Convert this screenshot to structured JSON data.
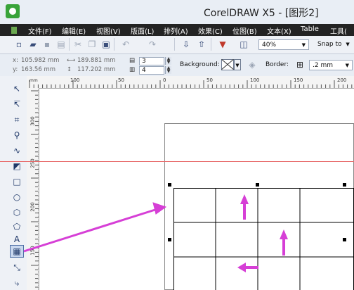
{
  "window": {
    "title": "CorelDRAW X5 - [图形2]"
  },
  "menu": {
    "items": [
      "文件(F)",
      "编辑(E)",
      "视图(V)",
      "版面(L)",
      "排列(A)",
      "效果(C)",
      "位图(B)",
      "文本(X)",
      "Table",
      "工具("
    ]
  },
  "toolbar": {
    "zoom_value": "40%",
    "snap_label": "Snap to"
  },
  "property_bar": {
    "x_label": "x:",
    "x_value": "105.982 mm",
    "y_label": "y:",
    "y_value": "163.56 mm",
    "width_value": "189.881 mm",
    "height_value": "117.202 mm",
    "rows_value": "3",
    "cols_value": "4",
    "background_label": "Background:",
    "border_label": "Border:",
    "border_width": ".2 mm"
  },
  "ruler": {
    "top_labels": [
      "100",
      "50",
      "0",
      "50",
      "100",
      "150",
      "200"
    ],
    "left_labels": [
      "300",
      "250",
      "200",
      "150"
    ],
    "unit": "mm"
  },
  "icons": {
    "standard_toolbar": [
      "new-document-icon",
      "open-icon",
      "save-icon",
      "print-icon",
      "cut-icon",
      "copy-icon",
      "paste-icon",
      "undo-icon",
      "redo-icon",
      "import-icon",
      "export-icon",
      "application-launcher-icon",
      "welcome-screen-icon"
    ],
    "toolbox": [
      "pick-tool-icon",
      "shape-tool-icon",
      "crop-tool-icon",
      "zoom-tool-icon",
      "freehand-tool-icon",
      "smart-fill-icon",
      "rectangle-tool-icon",
      "ellipse-tool-icon",
      "polygon-tool-icon",
      "basic-shapes-icon",
      "text-tool-icon",
      "table-tool-icon",
      "parallel-dimension-icon",
      "connector-tool-icon"
    ]
  },
  "colors": {
    "menu_background": "#232323",
    "guideline": "#e86a6a",
    "annotation_arrow": "#d63fd6"
  }
}
